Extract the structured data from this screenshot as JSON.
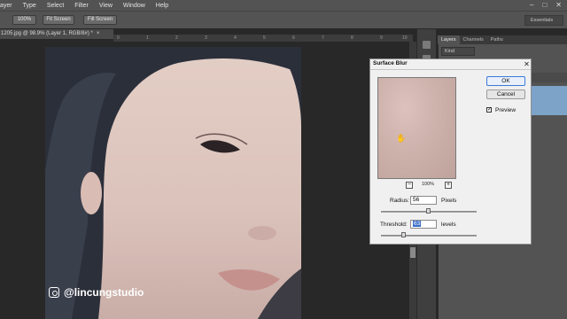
{
  "menu": [
    "ayer",
    "Type",
    "Select",
    "Filter",
    "View",
    "Window",
    "Help"
  ],
  "window_controls": [
    "–",
    "□",
    "✕"
  ],
  "options_bar": {
    "btn_100": "100%",
    "btn_fit": "Fit Screen",
    "btn_fill": "Fill Screen",
    "workspace": "Essentials"
  },
  "document": {
    "tab_title": "1205.jpg @ 98.9% (Layer 1, RGB/8#) *",
    "tab_close": "×",
    "ruler_marks": [
      "0",
      "1",
      "2",
      "3",
      "4",
      "5",
      "6",
      "7",
      "8",
      "9",
      "10"
    ]
  },
  "watermark": "@lincungstudio",
  "panel": {
    "tabs": [
      "Layers",
      "Channels",
      "Paths"
    ],
    "kind": "Kind"
  },
  "dialog": {
    "title": "Surface Blur",
    "close": "✕",
    "ok": "OK",
    "cancel": "Cancel",
    "preview_label": "Preview",
    "preview_checked": "✓",
    "zoom_minus": "−",
    "zoom_plus": "+",
    "zoom": "100%",
    "radius_label": "Radius:",
    "radius_value": "56",
    "radius_unit": "Pixels",
    "radius_level": 0.5,
    "threshold_label": "Threshold:",
    "threshold_value": "63",
    "threshold_unit": "levels",
    "threshold_level": 0.24,
    "hand_icon": "hand-icon"
  },
  "colors": {
    "chrome": "#535353",
    "dialog_bg": "#f0f0f0",
    "selection": "#3b6ec9",
    "layer_selected": "#7ea3c9"
  }
}
